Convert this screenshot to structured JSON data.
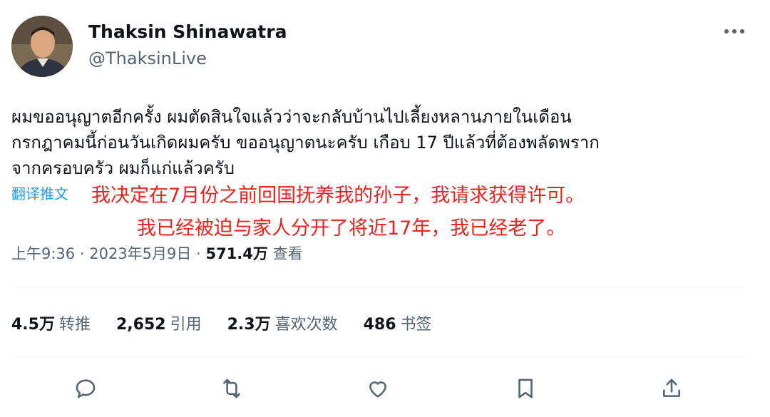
{
  "author": {
    "name": "Thaksin Shinawatra",
    "handle": "@ThaksinLive"
  },
  "tweet": {
    "lines": [
      "ผมขออนุญาตอีกครั้ง ผมตัดสินใจแล้วว่าจะกลับบ้านไปเลี้ยงหลานภายในเดือน",
      "กรกฎาคมนี้ก่อนวันเกิดผมครับ ขออนุญาตนะครับ เกือบ 17 ปีแล้วที่ต้องพลัดพราก",
      "จากครอบครัว ผมก็แก่แล้วครับ"
    ],
    "translate_label": "翻译推文"
  },
  "overlay": {
    "lines": [
      "我决定在7月份之前回国抚养我的孙子，我请求获得许可。",
      "我已经被迫与家人分开了将近17年，我已经老了。"
    ],
    "color": "#e8231f"
  },
  "meta": {
    "time": "上午9:36",
    "separator": "·",
    "date": "2023年5月9日",
    "views_count": "571.4万",
    "views_label": "查看"
  },
  "stats": [
    {
      "count": "4.5万",
      "label": "转推"
    },
    {
      "count": "2,652",
      "label": "引用"
    },
    {
      "count": "2.3万",
      "label": "喜欢次数"
    },
    {
      "count": "486",
      "label": "书签"
    }
  ],
  "actions": [
    "reply-icon",
    "retweet-icon",
    "like-icon",
    "bookmark-icon",
    "share-icon"
  ],
  "colors": {
    "accent": "#1d9bf0",
    "text": "#0f1419",
    "secondary": "#536471",
    "divider": "#eff3f4"
  }
}
